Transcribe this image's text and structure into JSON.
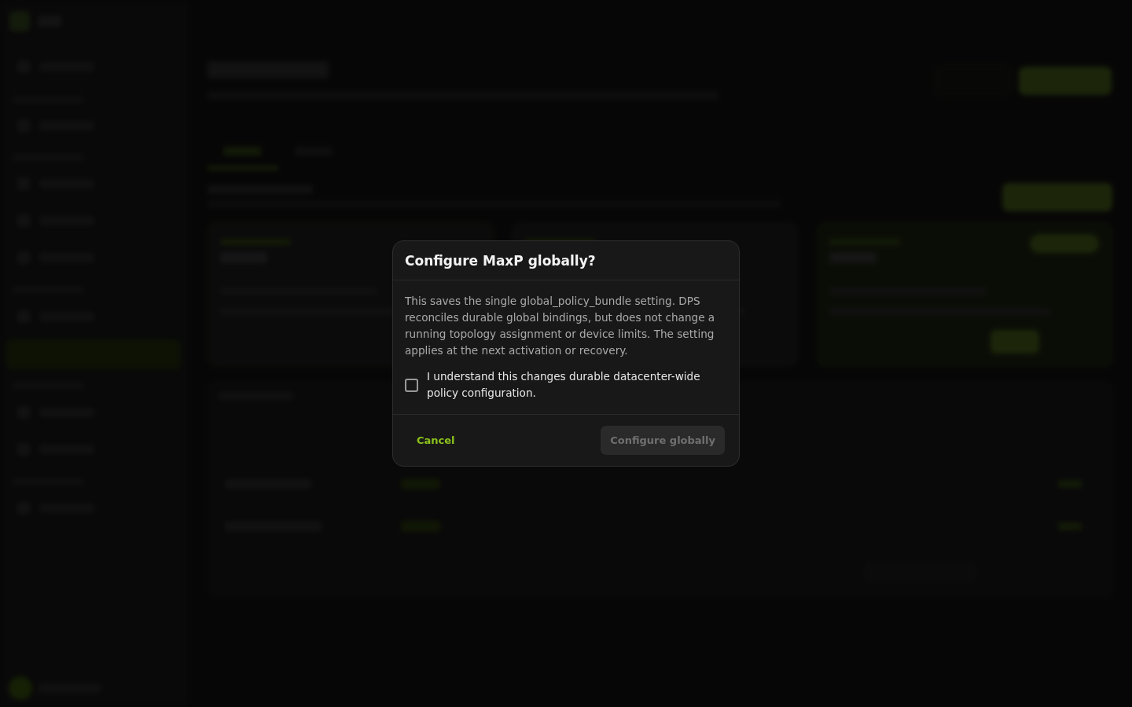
{
  "dialog": {
    "title": "Configure MaxP globally?",
    "message": "This saves the single global_policy_bundle setting. DPS reconciles durable global bindings, but does not change a running topology assignment or device limits. The setting applies at the next activation or recovery.",
    "confirmation": {
      "label": "I understand this changes durable datacenter-wide policy configuration.",
      "checked": false
    },
    "buttons": [
      {
        "label": "Cancel",
        "kind": "text",
        "disabled": false
      },
      {
        "label": "Configure globally",
        "kind": "primary",
        "disabled": true
      }
    ]
  }
}
